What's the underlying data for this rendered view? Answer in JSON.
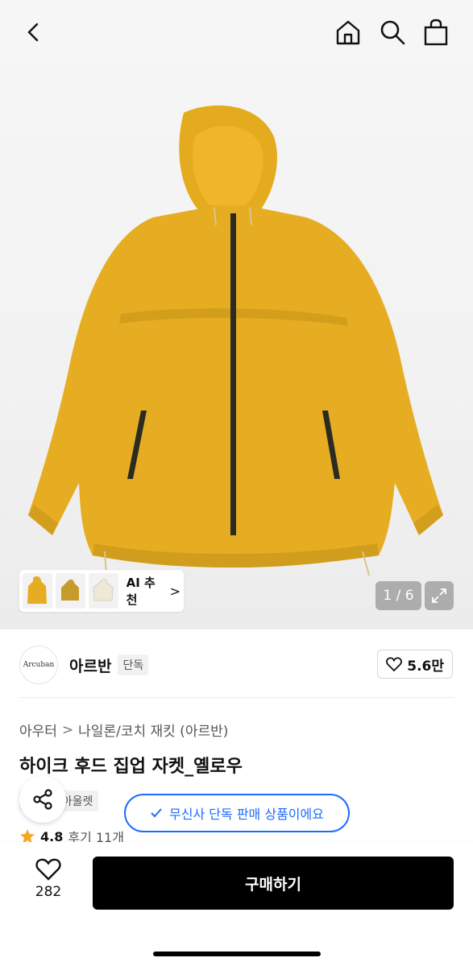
{
  "header": {
    "icons": [
      "back-icon",
      "home-icon",
      "search-icon",
      "shopping-bag-icon"
    ]
  },
  "hero": {
    "product_color": "#e8b020",
    "counter": "1 / 6",
    "ai_label": "AI 추천",
    "ai_chevron": ">"
  },
  "brand": {
    "logo_text": "Arcuban",
    "name": "아르반",
    "exclusive_badge": "단독",
    "likes": "5.6만"
  },
  "breadcrumb": {
    "level1": "아우터",
    "separator": ">",
    "level2": "나일론/코치 재킷 (아르반)"
  },
  "product": {
    "title": "하이크 후드 집업 자켓_옐로우",
    "tags": [
      "단독",
      "아울렛"
    ],
    "rating": "4.8",
    "review_label": "후기 11개"
  },
  "toast": {
    "text": "무신사 단독 판매 상품이에요"
  },
  "bottom": {
    "wish_count": "282",
    "buy_label": "구매하기"
  },
  "colors": {
    "accent_blue": "#1e6bff",
    "buy_button": "#000000",
    "star": "#f5a623"
  }
}
